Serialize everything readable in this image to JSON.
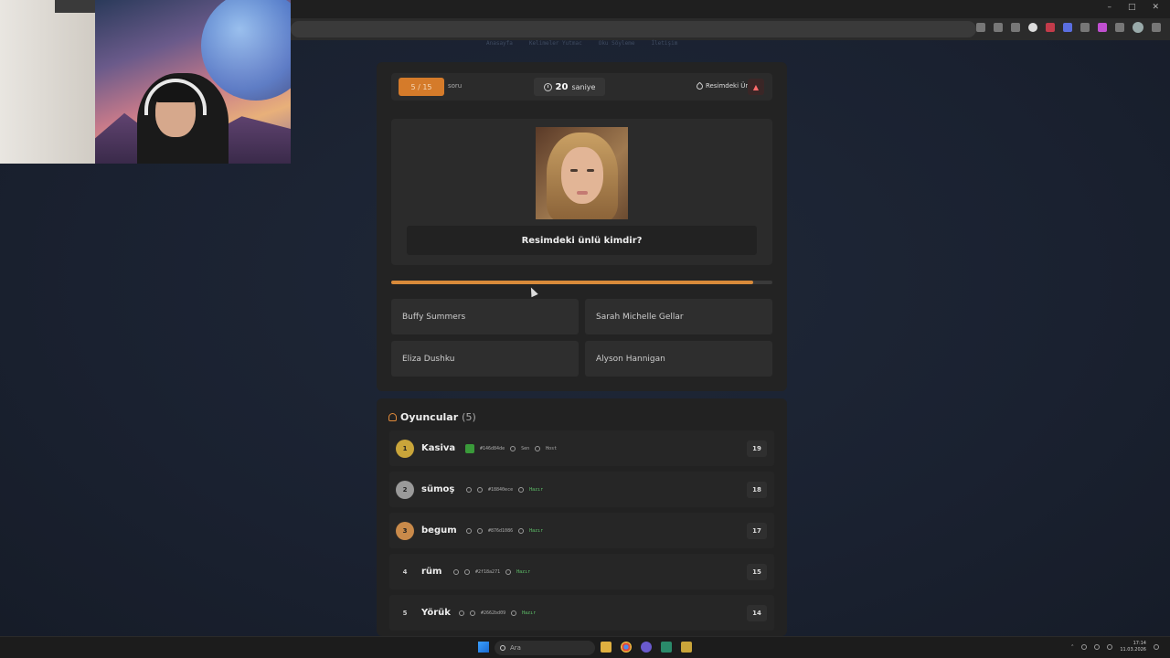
{
  "browser": {
    "window_controls": [
      "–",
      "□",
      "✕"
    ],
    "extension_icons": [
      "screen-share-icon",
      "star-icon",
      "ext-u-icon",
      "ext-circle-icon",
      "ext-red-icon",
      "ext-blue-icon",
      "ext-pencil-icon",
      "ext-pink-icon",
      "puzzle-icon",
      "profile-avatar-icon",
      "menu-icon"
    ]
  },
  "nav": {
    "items": [
      "Anasayfa",
      "Kelimeler Yutmac",
      "Oku Söyleme",
      "İletişim"
    ]
  },
  "game": {
    "question_counter": "5 / 15",
    "question_word": "soru",
    "timer_value": "20",
    "timer_unit": "saniye",
    "category": "Resimdeki Ünlü",
    "report_symbol": "▲",
    "question_text": "Resimdeki ünlü kimdir?",
    "time_progress": 0.95,
    "answers": [
      "Buffy Summers",
      "Sarah Michelle Gellar",
      "Eliza Dushku",
      "Alyson Hannigan"
    ]
  },
  "players": {
    "title": "Oyuncular",
    "count": "(5)",
    "list": [
      {
        "rank": "1",
        "name": "Kasiva",
        "id": "#146d84de",
        "tag1": "Sen",
        "tag2": "Host",
        "score": "19",
        "color": "#c9a53a"
      },
      {
        "rank": "2",
        "name": "sümoş",
        "id": "#18840ece",
        "status": "Hazır",
        "score": "18",
        "color": "#9a9a9a"
      },
      {
        "rank": "3",
        "name": "begum",
        "id": "#876d1086",
        "status": "Hazır",
        "score": "17",
        "color": "#c98a4a"
      },
      {
        "rank": "4",
        "name": "rüm",
        "id": "#2f18a271",
        "status": "Hazır",
        "score": "15",
        "color": ""
      },
      {
        "rank": "5",
        "name": "Yörük",
        "id": "#2662bd09",
        "status": "Hazır",
        "score": "14",
        "color": ""
      }
    ]
  },
  "taskbar": {
    "search_placeholder": "Ara",
    "time": "17:14",
    "date": "11.03.2026"
  },
  "colors": {
    "accent": "#d57b2a",
    "ready": "#5fc36a",
    "background": "#1b2230"
  }
}
